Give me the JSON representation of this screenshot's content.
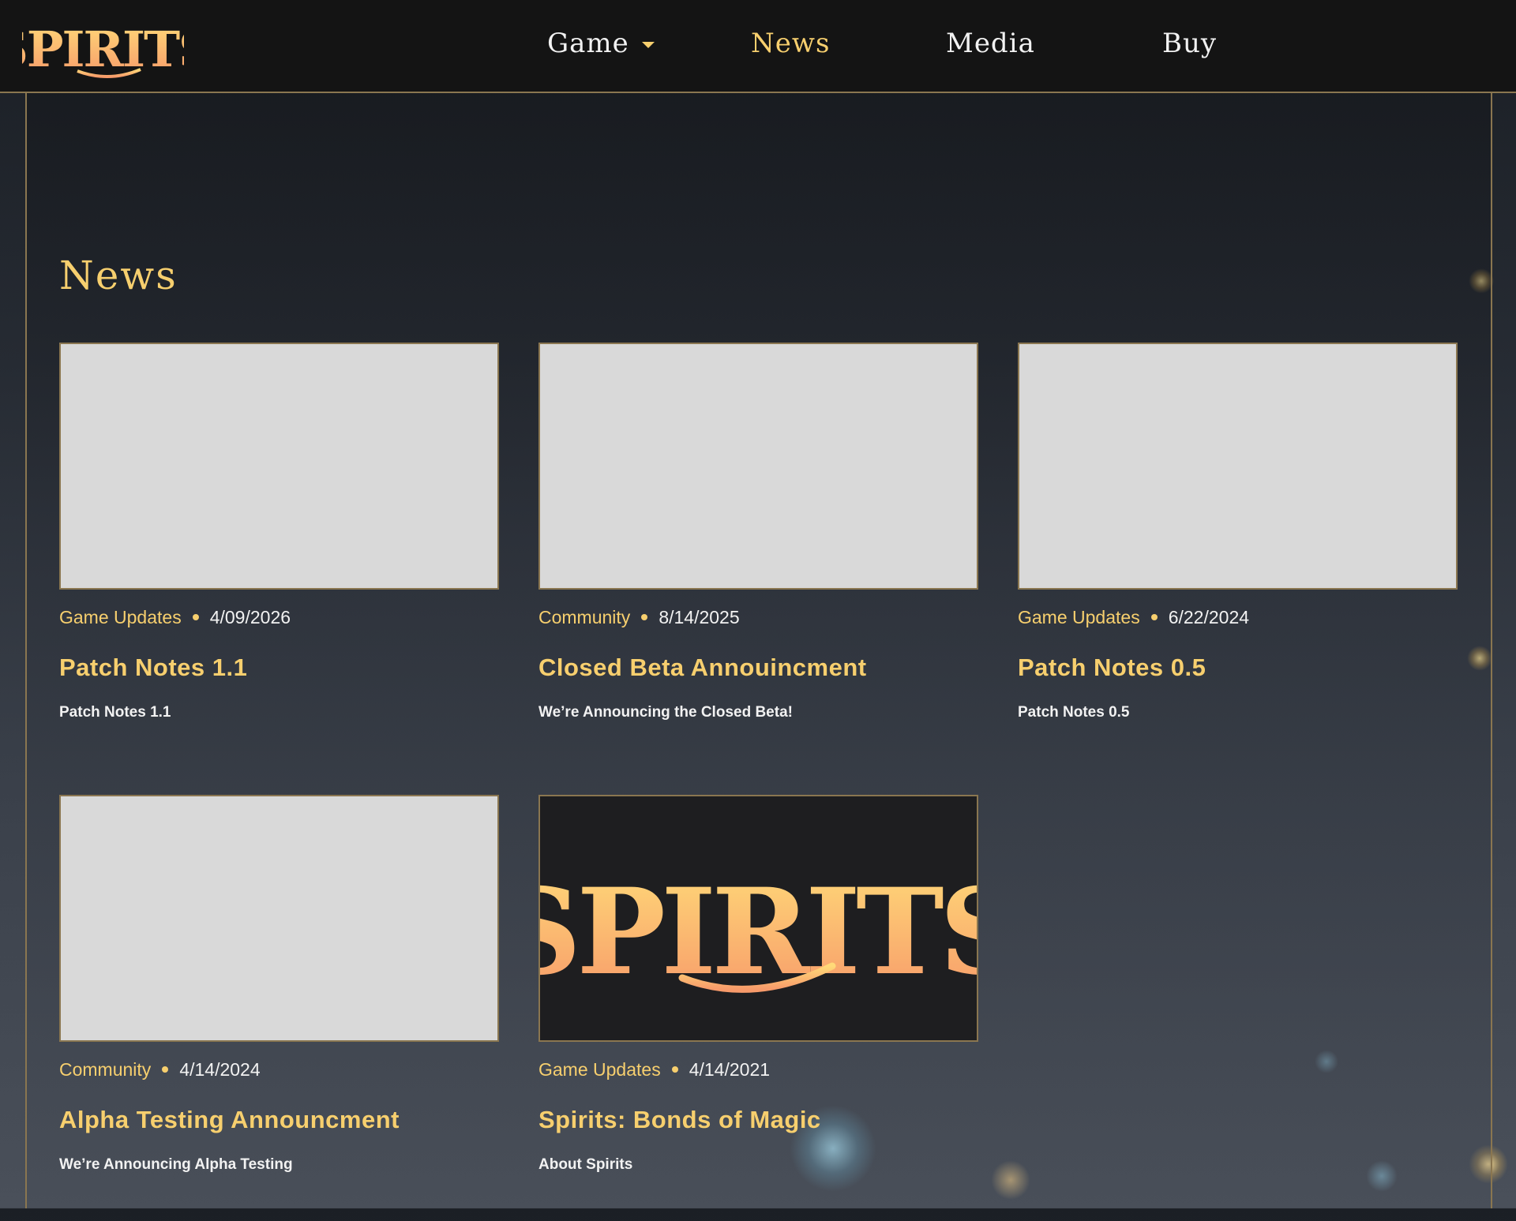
{
  "brand": {
    "logo_text": "SPIRITS",
    "gold": "#f7cf6e",
    "border_gold": "#8a7650"
  },
  "nav": {
    "items": [
      {
        "label": "Game",
        "has_dropdown": true,
        "active": false
      },
      {
        "label": "News",
        "has_dropdown": false,
        "active": true
      },
      {
        "label": "Media",
        "has_dropdown": false,
        "active": false
      },
      {
        "label": "Buy",
        "has_dropdown": false,
        "active": false
      }
    ]
  },
  "page": {
    "title": "News"
  },
  "cards": [
    {
      "category": "Game Updates",
      "date": "4/09/2026",
      "title": "Patch Notes 1.1",
      "description": "Patch Notes 1.1",
      "image": "placeholder"
    },
    {
      "category": "Community",
      "date": "8/14/2025",
      "title": "Closed Beta Annouincment",
      "description": "We’re Announcing the Closed Beta!",
      "image": "placeholder"
    },
    {
      "category": "Game Updates",
      "date": "6/22/2024",
      "title": "Patch Notes 0.5",
      "description": "Patch Notes 0.5",
      "image": "placeholder"
    },
    {
      "category": "Community",
      "date": "4/14/2024",
      "title": "Alpha Testing Announcment",
      "description": "We’re Announcing Alpha Testing",
      "image": "placeholder"
    },
    {
      "category": "Game Updates",
      "date": "4/14/2021",
      "title": "Spirits: Bonds of Magic",
      "description": "About Spirits",
      "image": "spirits-logo"
    }
  ]
}
